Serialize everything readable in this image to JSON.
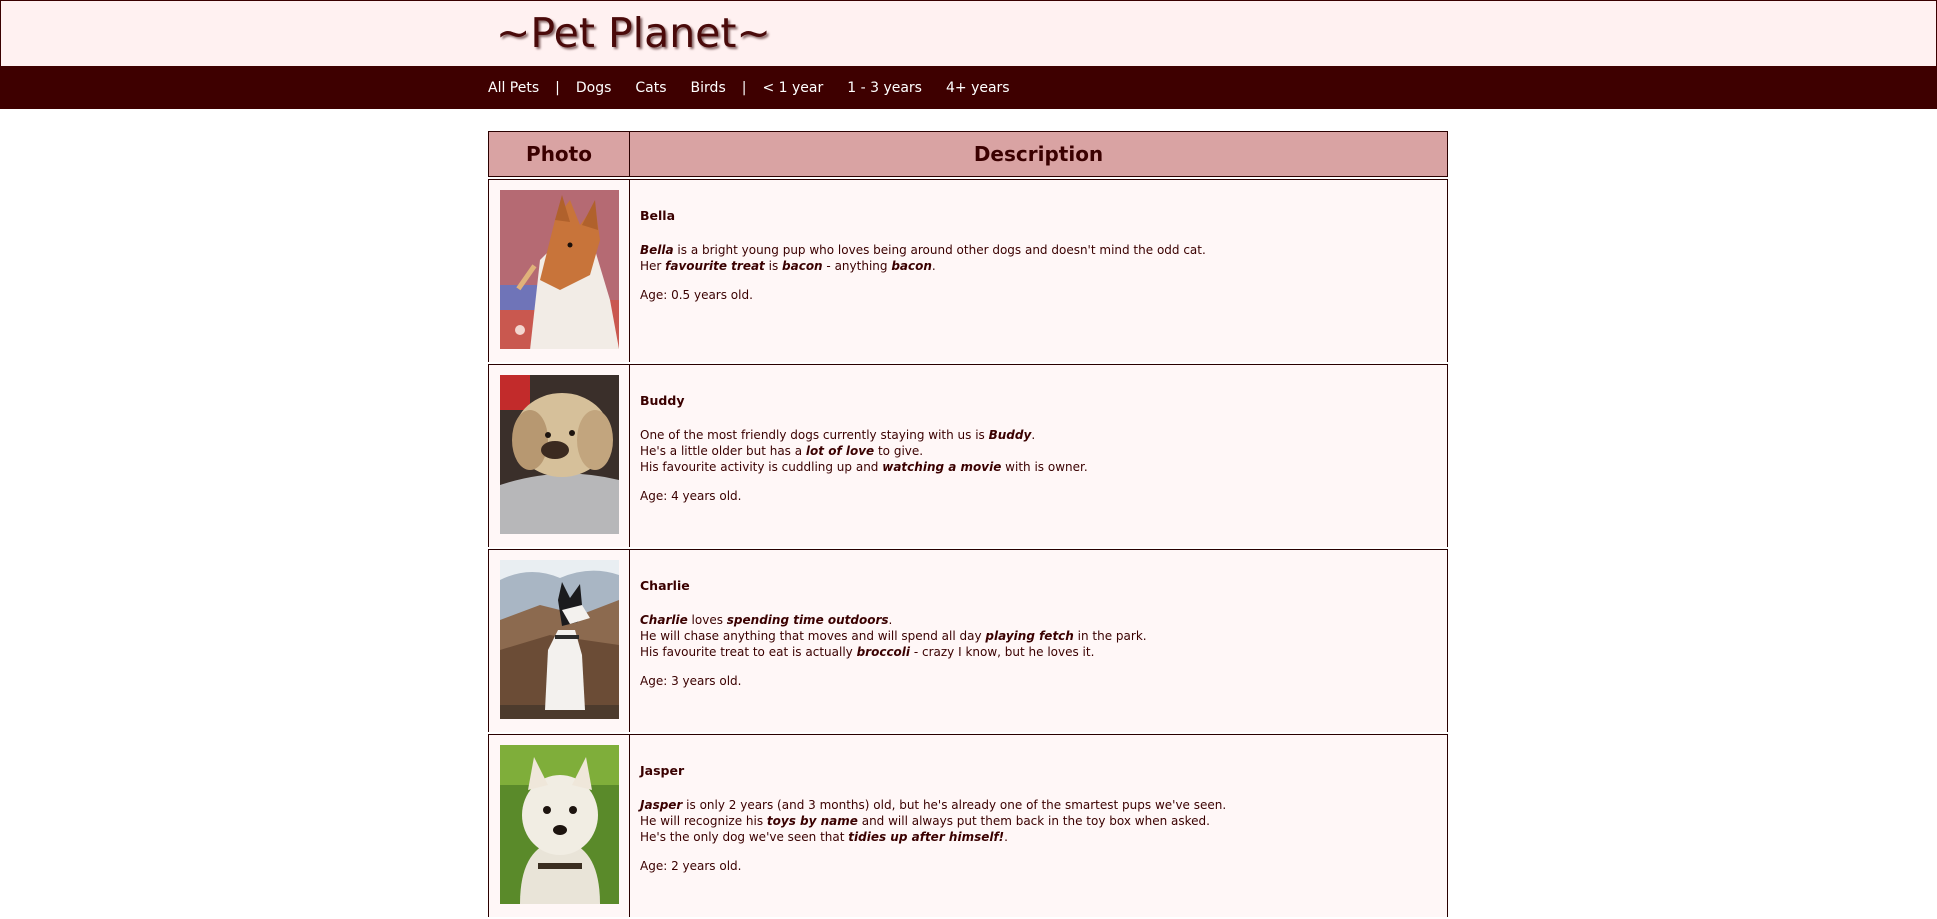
{
  "site": {
    "title": "~Pet Planet~"
  },
  "nav": {
    "items": [
      {
        "label": "All Pets"
      },
      {
        "label": "|"
      },
      {
        "label": "Dogs"
      },
      {
        "label": "Cats"
      },
      {
        "label": "Birds"
      },
      {
        "label": "|"
      },
      {
        "label": "< 1 year"
      },
      {
        "label": "1 - 3 years"
      },
      {
        "label": "4+ years"
      }
    ]
  },
  "table": {
    "headers": {
      "photo": "Photo",
      "description": "Description"
    },
    "rows": [
      {
        "name": "Bella",
        "photo_icon": "dog-photo-bella",
        "lines": [
          [
            {
              "t": "Bella",
              "b": true
            },
            {
              "t": " is a bright young pup who loves being around other dogs and doesn't mind the odd cat."
            }
          ],
          [
            {
              "t": "Her "
            },
            {
              "t": "favourite treat",
              "b": true
            },
            {
              "t": " is "
            },
            {
              "t": "bacon",
              "b": true
            },
            {
              "t": " - anything "
            },
            {
              "t": "bacon",
              "b": true
            },
            {
              "t": "."
            }
          ]
        ],
        "age": "Age: 0.5 years old."
      },
      {
        "name": "Buddy",
        "photo_icon": "dog-photo-buddy",
        "lines": [
          [
            {
              "t": "One of the most friendly dogs currently staying with us is "
            },
            {
              "t": "Buddy",
              "b": true
            },
            {
              "t": "."
            }
          ],
          [
            {
              "t": "He's a little older but has a "
            },
            {
              "t": "lot of love",
              "b": true
            },
            {
              "t": " to give."
            }
          ],
          [
            {
              "t": "His favourite activity is cuddling up and "
            },
            {
              "t": "watching a movie",
              "b": true
            },
            {
              "t": " with is owner."
            }
          ]
        ],
        "age": "Age: 4 years old."
      },
      {
        "name": "Charlie",
        "photo_icon": "dog-photo-charlie",
        "lines": [
          [
            {
              "t": "Charlie",
              "b": true
            },
            {
              "t": " loves "
            },
            {
              "t": "spending time outdoors",
              "b": true
            },
            {
              "t": "."
            }
          ],
          [
            {
              "t": "He will chase anything that moves and will spend all day "
            },
            {
              "t": "playing fetch",
              "b": true
            },
            {
              "t": " in the park."
            }
          ],
          [
            {
              "t": "His favourite treat to eat is actually "
            },
            {
              "t": "broccoli",
              "b": true
            },
            {
              "t": " - crazy I know, but he loves it."
            }
          ]
        ],
        "age": "Age: 3 years old."
      },
      {
        "name": "Jasper",
        "photo_icon": "dog-photo-jasper",
        "lines": [
          [
            {
              "t": "Jasper",
              "b": true
            },
            {
              "t": " is only 2 years (and 3 months) old, but he's already one of the smartest pups we've seen."
            }
          ],
          [
            {
              "t": "He will recognize his "
            },
            {
              "t": "toys by name",
              "b": true
            },
            {
              "t": " and will always put them back in the toy box when asked."
            }
          ],
          [
            {
              "t": "He's the only dog we've seen that "
            },
            {
              "t": "tidies up after himself!",
              "b": true
            },
            {
              "t": "."
            }
          ]
        ],
        "age": "Age: 2 years old."
      }
    ]
  },
  "colors": {
    "header_bg": "#fff1f1",
    "nav_bg": "#3e0000",
    "table_header_bg": "#d9a3a3",
    "cell_bg": "#fff7f7",
    "text": "#3a0000"
  }
}
